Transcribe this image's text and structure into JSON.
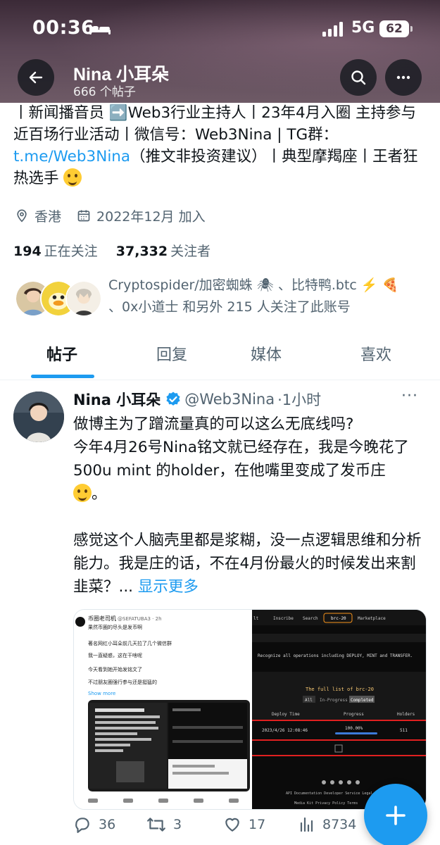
{
  "status_bar": {
    "time": "00:36",
    "network": "5G",
    "battery": "62"
  },
  "header": {
    "title": "Nina 小耳朵",
    "subtitle": "666 个帖子"
  },
  "bio": {
    "line1": "丨新闻播音员 ➡️Web3行业主持人丨23年4月入圈 主持参与近百场行业活动丨微信号：Web3Nina | TG群：",
    "link": "t.me/Web3Nina",
    "line2": "（推文非投资建议）丨典型摩羯座丨王者狂热选手"
  },
  "profile_meta": {
    "location": "香港",
    "joined": "2022年12月 加入"
  },
  "follow_stats": {
    "following_count": "194",
    "following_label": "正在关注",
    "followers_count": "37,332",
    "followers_label": "关注者"
  },
  "followed_by": "Cryptospider/加密蜘蛛 🕷 、比特鸭.btc ⚡️ 🍕 、0x小道士 和另外 215 人关注了此账号",
  "tabs": [
    {
      "label": "帖子"
    },
    {
      "label": "回复"
    },
    {
      "label": "媒体"
    },
    {
      "label": "喜欢"
    }
  ],
  "tweet": {
    "name": "Nina 小耳朵",
    "handle": "@Web3Nina",
    "time": "·1小时",
    "para1": "做博主为了蹭流量真的可以这么无底线吗?\n今年4月26号Nina铭文就已经存在，我是今晚花了500u mint 的holder，在他嘴里变成了发币庄",
    "para1_tail": "。",
    "para2": "感觉这个人脑壳里都是浆糊，没一点逻辑思维和分析能力。我是庄的话，不在4月份最火的时候发出来割韭菜？...",
    "show_more": "显示更多",
    "media_left_name": "币圈老司机",
    "media_left_handle": "@SEFATUBA3 · 2h",
    "media_left_lines": [
      "果然币圈的尽头是发币啊",
      "著名网红小耳朵前几天拉了几个微信群",
      "我一直疑惑，这在干啥呢",
      "今天看到她开始发铭文了",
      "不过朋友圈强行参与还是挺猛的"
    ],
    "media_left_show_more": "Show more",
    "media_right_nav": [
      "lt",
      "Inscribe",
      "Search",
      "brc-20",
      "Marketplace"
    ],
    "media_right_desc": "Recognize all operations including DEPLOY, MINT and TRANSFER.",
    "media_right_heading": "The full list of brc-20",
    "media_right_filters": [
      "All",
      "In-Progress",
      "Completed"
    ],
    "media_right_cols": [
      "Deploy Time",
      "Progress",
      "Holders"
    ],
    "media_right_row": [
      "2023/4/26 12:08:46",
      "100.00%",
      "511"
    ],
    "media_right_footer": "API Documentation   Developer Service Legal",
    "media_right_footer2": "Media Kit   Privacy Policy   Terms"
  },
  "actions": {
    "replies": "36",
    "retweets": "3",
    "likes": "17",
    "views": "8734"
  },
  "colors": {
    "accent": "#1d9bf0",
    "text": "#0f1419",
    "muted": "#536471"
  }
}
